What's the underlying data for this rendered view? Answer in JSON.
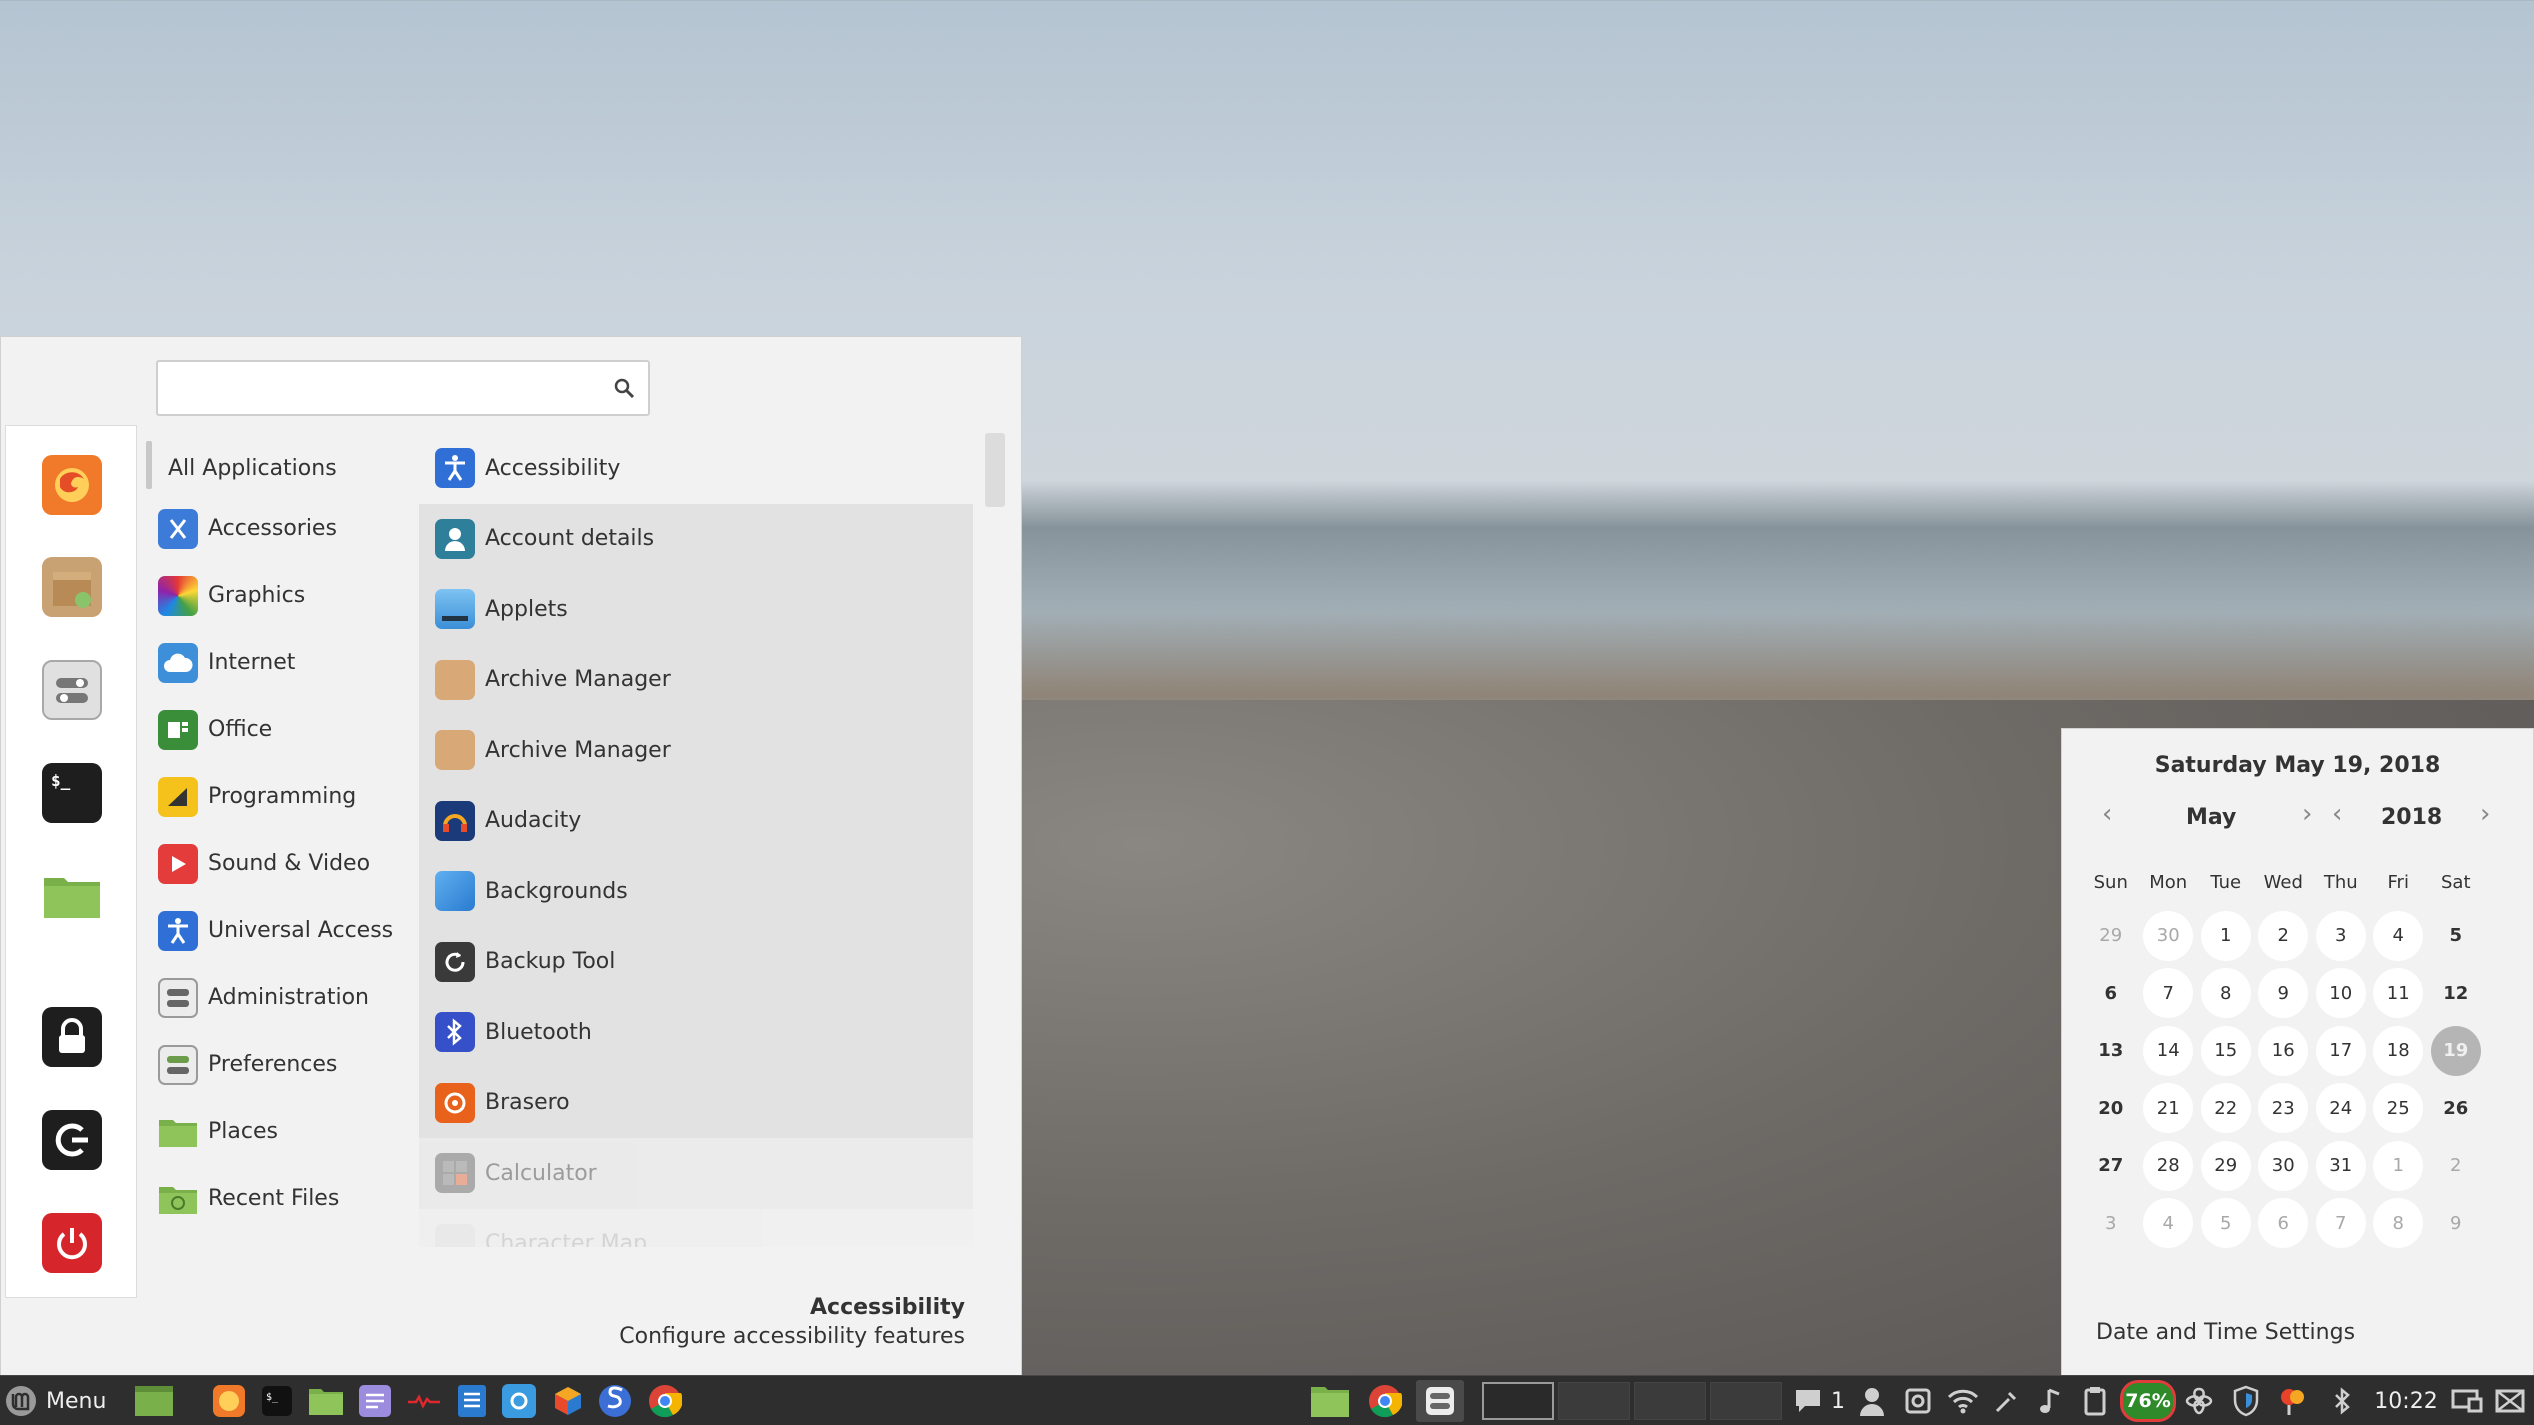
{
  "menu": {
    "search": {
      "value": "",
      "placeholder": "",
      "cursor": "I"
    },
    "favorites": [
      "firefox-icon",
      "package-icon",
      "settings-toggle-icon",
      "terminal-icon",
      "folder-icon",
      "lock-icon",
      "logout-icon",
      "power-icon"
    ],
    "categories": [
      {
        "label": "All Applications",
        "icon": ""
      },
      {
        "label": "Accessories",
        "icon": "accessories-icon"
      },
      {
        "label": "Graphics",
        "icon": "graphics-icon"
      },
      {
        "label": "Internet",
        "icon": "internet-icon"
      },
      {
        "label": "Office",
        "icon": "office-icon"
      },
      {
        "label": "Programming",
        "icon": "programming-icon"
      },
      {
        "label": "Sound & Video",
        "icon": "sound-video-icon"
      },
      {
        "label": "Universal Access",
        "icon": "universal-access-icon"
      },
      {
        "label": "Administration",
        "icon": "administration-icon"
      },
      {
        "label": "Preferences",
        "icon": "preferences-icon"
      },
      {
        "label": "Places",
        "icon": "places-icon"
      },
      {
        "label": "Recent Files",
        "icon": "recent-files-icon"
      }
    ],
    "apps": [
      {
        "label": "Accessibility",
        "icon": "accessibility-icon"
      },
      {
        "label": "Account details",
        "icon": "account-icon"
      },
      {
        "label": "Applets",
        "icon": "applets-icon"
      },
      {
        "label": "Archive Manager",
        "icon": "archive-icon"
      },
      {
        "label": "Archive Manager",
        "icon": "archive-icon"
      },
      {
        "label": "Audacity",
        "icon": "audacity-icon"
      },
      {
        "label": "Backgrounds",
        "icon": "backgrounds-icon"
      },
      {
        "label": "Backup Tool",
        "icon": "backup-icon"
      },
      {
        "label": "Bluetooth",
        "icon": "bluetooth-icon"
      },
      {
        "label": "Brasero",
        "icon": "brasero-icon"
      },
      {
        "label": "Calculator",
        "icon": "calculator-icon"
      },
      {
        "label": "Character Map",
        "icon": "character-map-icon"
      }
    ],
    "description": {
      "title": "Accessibility",
      "text": "Configure accessibility features"
    }
  },
  "calendar": {
    "date_heading": "Saturday May 19, 2018",
    "month": "May",
    "year": "2018",
    "weekdays": [
      "Sun",
      "Mon",
      "Tue",
      "Wed",
      "Thu",
      "Fri",
      "Sat"
    ],
    "weeks": [
      [
        "29",
        "30",
        "1",
        "2",
        "3",
        "4",
        "5"
      ],
      [
        "6",
        "7",
        "8",
        "9",
        "10",
        "11",
        "12"
      ],
      [
        "13",
        "14",
        "15",
        "16",
        "17",
        "18",
        "19"
      ],
      [
        "20",
        "21",
        "22",
        "23",
        "24",
        "25",
        "26"
      ],
      [
        "27",
        "28",
        "29",
        "30",
        "31",
        "1",
        "2"
      ],
      [
        "3",
        "4",
        "5",
        "6",
        "7",
        "8",
        "9"
      ]
    ],
    "today": "19",
    "settings_label": "Date and Time Settings"
  },
  "panel": {
    "menu_label": "Menu",
    "notification_count": "1",
    "battery": "76%",
    "clock": "10:22",
    "colors": {
      "battery_fill": "#2f8a2a",
      "battery_ring": "#e03c3c"
    }
  }
}
